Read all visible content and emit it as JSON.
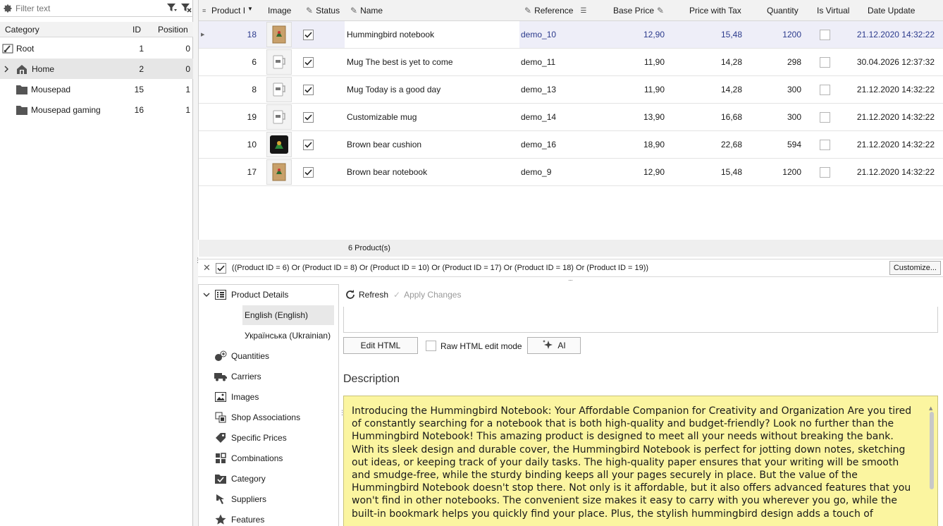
{
  "filter": {
    "placeholder": "Filter text"
  },
  "categories": {
    "headers": {
      "category": "Category",
      "id": "ID",
      "position": "Position"
    },
    "rows": [
      {
        "name": "Root",
        "id": "1",
        "position": "0",
        "icon": "root-icon"
      },
      {
        "name": "Home",
        "id": "2",
        "position": "0",
        "icon": "home-icon"
      },
      {
        "name": "Mousepad",
        "id": "15",
        "position": "1",
        "icon": "folder-icon"
      },
      {
        "name": "Mousepad gaming",
        "id": "16",
        "position": "1",
        "icon": "folder-icon"
      }
    ]
  },
  "grid": {
    "headers": {
      "product_id": "Product I",
      "image": "Image",
      "status": "Status",
      "name": "Name",
      "reference": "Reference",
      "base_price": "Base Price",
      "price_tax": "Price with Tax",
      "quantity": "Quantity",
      "is_virtual": "Is Virtual",
      "date_update": "Date Update"
    },
    "rows": [
      {
        "id": "18",
        "status": true,
        "name": "Hummingbird notebook",
        "reference": "demo_10",
        "base_price": "12,90",
        "price_tax": "15,48",
        "quantity": "1200",
        "is_virtual": false,
        "date_update": "21.12.2020 14:32:22",
        "thumb": "notebook"
      },
      {
        "id": "6",
        "status": true,
        "name": "Mug The best is yet to come",
        "reference": "demo_11",
        "base_price": "11,90",
        "price_tax": "14,28",
        "quantity": "298",
        "is_virtual": false,
        "date_update": "30.04.2026 12:37:32",
        "thumb": "mug"
      },
      {
        "id": "8",
        "status": true,
        "name": "Mug Today is a good day",
        "reference": "demo_13",
        "base_price": "11,90",
        "price_tax": "14,28",
        "quantity": "300",
        "is_virtual": false,
        "date_update": "21.12.2020 14:32:22",
        "thumb": "mug"
      },
      {
        "id": "19",
        "status": true,
        "name": "Customizable mug",
        "reference": "demo_14",
        "base_price": "13,90",
        "price_tax": "16,68",
        "quantity": "300",
        "is_virtual": false,
        "date_update": "21.12.2020 14:32:22",
        "thumb": "mug"
      },
      {
        "id": "10",
        "status": true,
        "name": "Brown bear cushion",
        "reference": "demo_16",
        "base_price": "18,90",
        "price_tax": "22,68",
        "quantity": "594",
        "is_virtual": false,
        "date_update": "21.12.2020 14:32:22",
        "thumb": "cushion"
      },
      {
        "id": "17",
        "status": true,
        "name": "Brown bear notebook",
        "reference": "demo_9",
        "base_price": "12,90",
        "price_tax": "15,48",
        "quantity": "1200",
        "is_virtual": false,
        "date_update": "21.12.2020 14:32:22",
        "thumb": "notebook"
      }
    ],
    "footer": "6 Product(s)"
  },
  "filter_expression": {
    "text": "((Product ID = 6) Or (Product ID = 8) Or (Product ID = 10) Or (Product ID = 17) Or (Product ID = 18) Or (Product ID = 19))",
    "customize": "Customize..."
  },
  "nav": {
    "product_details": "Product Details",
    "lang_en": "English (English)",
    "lang_uk": "Українська (Ukrainian)",
    "quantities": "Quantities",
    "carriers": "Carriers",
    "images": "Images",
    "shop_associations": "Shop Associations",
    "specific_prices": "Specific Prices",
    "combinations": "Combinations",
    "category": "Category",
    "suppliers": "Suppliers",
    "features": "Features"
  },
  "editor": {
    "refresh": "Refresh",
    "apply_changes": "Apply Changes",
    "edit_html": "Edit HTML",
    "raw_html": "Raw HTML edit mode",
    "ai": "AI",
    "description_title": "Description",
    "description_text": "Introducing the Hummingbird Notebook: Your Affordable Companion for Creativity and Organization Are you tired of constantly searching for a notebook that is both high-quality and budget-friendly? Look no further than the Hummingbird Notebook! This amazing product is designed to meet all your needs without breaking the bank. With its sleek design and durable cover, the Hummingbird Notebook is perfect for jotting down notes, sketching out ideas, or keeping track of your daily tasks. The high-quality paper ensures that your writing will be smooth and smudge-free, while the sturdy binding keeps all your pages securely in place. But the value of the Hummingbird Notebook doesn't stop there. Not only is it affordable, but it also offers advanced features that you won't find in other notebooks. The convenient size makes it easy to carry with you wherever you go, while the built-in bookmark helps you quickly find your place. Plus, the stylish hummingbird design adds a touch of"
  },
  "colors": {
    "selected_row_text": "#2b3a8c",
    "description_bg": "#fbf5a0",
    "selected_row_bg": "#eeeef8"
  }
}
